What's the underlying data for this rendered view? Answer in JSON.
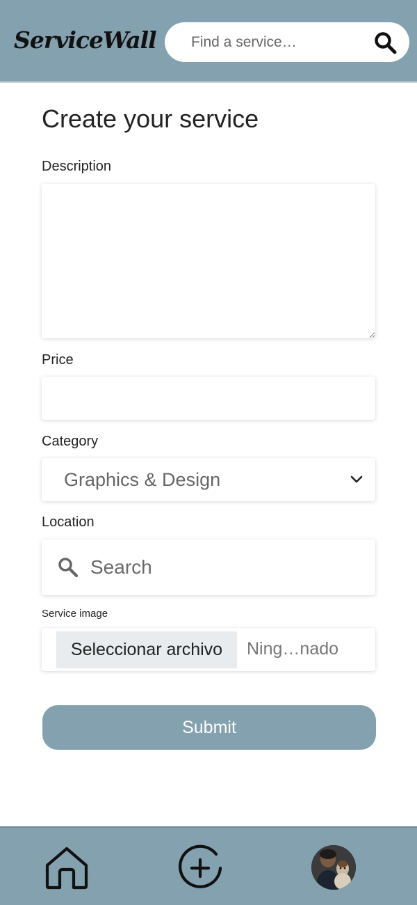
{
  "header": {
    "logo": "ServiceWall",
    "search_placeholder": "Find a service…"
  },
  "form": {
    "title": "Create your service",
    "description_label": "Description",
    "price_label": "Price",
    "category_label": "Category",
    "category_selected": "Graphics & Design",
    "location_label": "Location",
    "location_placeholder": "Search",
    "image_label": "Service image",
    "file_button": "Seleccionar archivo",
    "file_status": "Ning…nado",
    "submit_label": "Submit"
  },
  "icons": {
    "search": "search-icon",
    "chevron": "chevron-down-icon",
    "location_search": "search-icon",
    "home": "home-icon",
    "add": "add-circle-icon",
    "avatar": "avatar"
  },
  "colors": {
    "accent": "#84a1af",
    "file_button_bg": "#e8ecef"
  }
}
